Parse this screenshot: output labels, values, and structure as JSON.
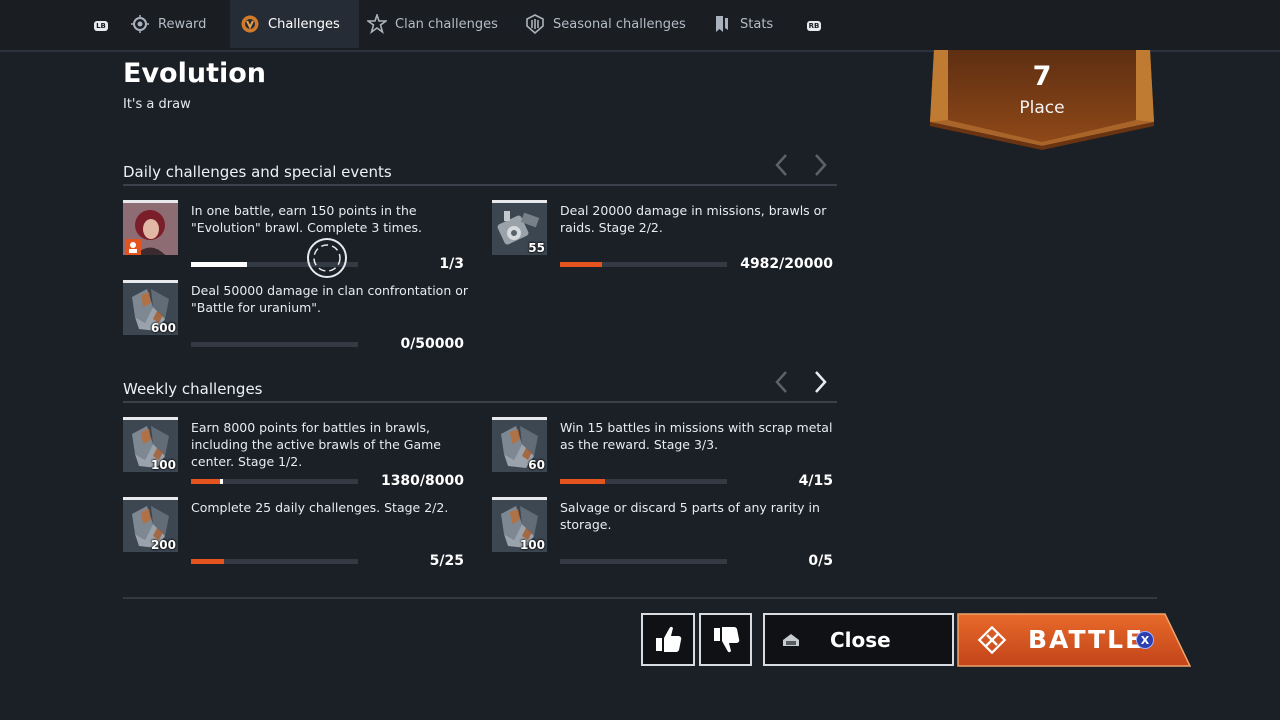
{
  "nav": {
    "lb": "LB",
    "rb": "RB",
    "tabs": [
      {
        "label": "Reward",
        "icon": "reward-icon"
      },
      {
        "label": "Challenges",
        "icon": "challenges-icon",
        "active": true
      },
      {
        "label": "Clan challenges",
        "icon": "clan-challenges-icon"
      },
      {
        "label": "Seasonal challenges",
        "icon": "seasonal-challenges-icon"
      },
      {
        "label": "Stats",
        "icon": "stats-icon"
      }
    ]
  },
  "header": {
    "title": "Evolution",
    "subtitle": "It's a draw"
  },
  "place": {
    "number": "7",
    "label": "Place"
  },
  "daily": {
    "title": "Daily challenges and special events",
    "items": [
      {
        "text": "In one battle, earn 150 points in the \"Evolution\" brawl. Complete 3 times.",
        "progress": "1/3",
        "fraction": 0.333,
        "icon": "character-portrait-icon"
      },
      {
        "text": "Deal 20000 damage in missions, brawls or raids. Stage 2/2.",
        "progress": "4982/20000",
        "fraction": 0.249,
        "reward": "55",
        "icon": "scrap-parts-icon"
      },
      {
        "text": "Deal 50000 damage in clan confrontation or \"Battle for uranium\".",
        "progress": "0/50000",
        "fraction": 0,
        "reward": "600",
        "icon": "scrap-metal-icon"
      }
    ]
  },
  "weekly": {
    "title": "Weekly challenges",
    "items": [
      {
        "text": "Earn 8000 points for battles in brawls, including the active brawls of the Game center. Stage 1/2.",
        "progress": "1380/8000",
        "fraction": 0.1725,
        "reward": "100",
        "icon": "scrap-metal-icon"
      },
      {
        "text": "Win 15 battles in missions with scrap metal as the reward. Stage 3/3.",
        "progress": "4/15",
        "fraction": 0.267,
        "reward": "60",
        "icon": "scrap-metal-icon"
      },
      {
        "text": "Complete 25 daily challenges.  Stage 2/2.",
        "progress": "5/25",
        "fraction": 0.2,
        "reward": "200",
        "icon": "scrap-metal-icon"
      },
      {
        "text": "Salvage or discard 5 parts of any rarity in storage.",
        "progress": "0/5",
        "fraction": 0,
        "reward": "100",
        "icon": "scrap-metal-icon"
      }
    ]
  },
  "actions": {
    "close": "Close",
    "battle": "BATTLE",
    "battle_button_glyph": "X"
  },
  "colors": {
    "accent": "#e5541e",
    "battle": "#d9521c",
    "banner": "#8a4418"
  }
}
